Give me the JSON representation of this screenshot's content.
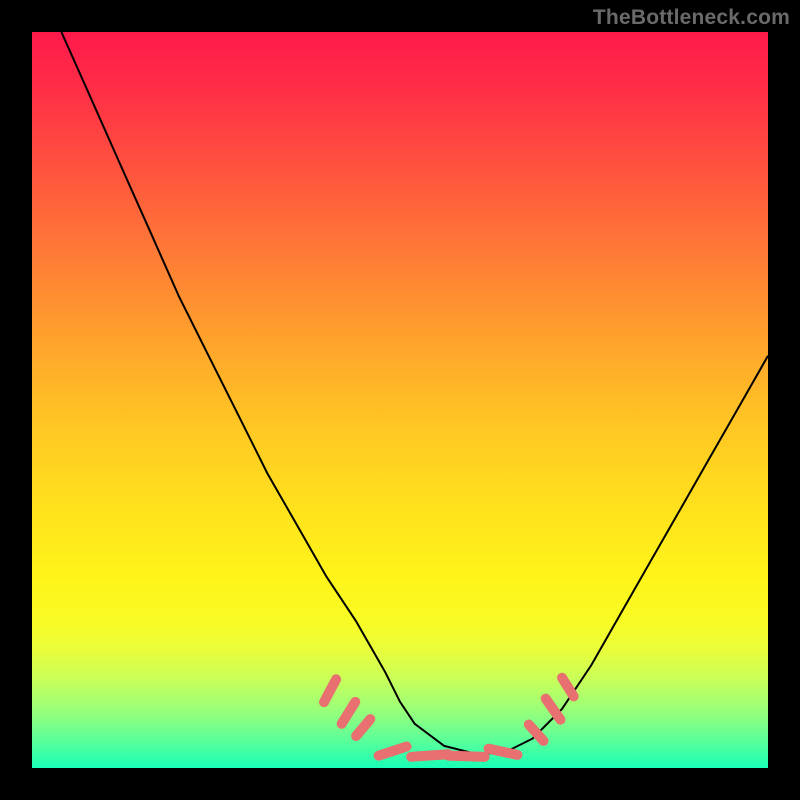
{
  "watermark": "TheBottleneck.com",
  "colors": {
    "frame": "#000000",
    "gradient_top": "#ff194b",
    "gradient_bottom": "#1affb6",
    "curve": "#000000",
    "markers": "#e97070"
  },
  "chart_data": {
    "type": "line",
    "title": "",
    "xlabel": "",
    "ylabel": "",
    "xlim": [
      0,
      100
    ],
    "ylim": [
      0,
      100
    ],
    "grid": false,
    "legend": false,
    "series": [
      {
        "name": "bottleneck-curve",
        "x": [
          4,
          8,
          12,
          16,
          20,
          24,
          28,
          32,
          36,
          40,
          44,
          48,
          50,
          52,
          56,
          60,
          64,
          68,
          72,
          76,
          80,
          84,
          88,
          92,
          96,
          100
        ],
        "y": [
          100,
          91,
          82,
          73,
          64,
          56,
          48,
          40,
          33,
          26,
          20,
          13,
          9,
          6,
          3,
          2,
          2,
          4,
          8,
          14,
          21,
          28,
          35,
          42,
          49,
          56
        ]
      }
    ],
    "markers": [
      {
        "x": 40.5,
        "y": 10.5,
        "len": 3.5,
        "angle": -62
      },
      {
        "x": 43.0,
        "y": 7.5,
        "len": 3.5,
        "angle": -58
      },
      {
        "x": 45.0,
        "y": 5.5,
        "len": 3.0,
        "angle": -50
      },
      {
        "x": 49.0,
        "y": 2.3,
        "len": 4.0,
        "angle": -18
      },
      {
        "x": 54.0,
        "y": 1.7,
        "len": 5.0,
        "angle": -4
      },
      {
        "x": 59.0,
        "y": 1.6,
        "len": 5.0,
        "angle": 2
      },
      {
        "x": 64.0,
        "y": 2.2,
        "len": 4.0,
        "angle": 12
      },
      {
        "x": 68.5,
        "y": 4.8,
        "len": 3.0,
        "angle": 48
      },
      {
        "x": 70.8,
        "y": 8.0,
        "len": 3.5,
        "angle": 55
      },
      {
        "x": 72.8,
        "y": 11.0,
        "len": 3.0,
        "angle": 58
      }
    ]
  }
}
